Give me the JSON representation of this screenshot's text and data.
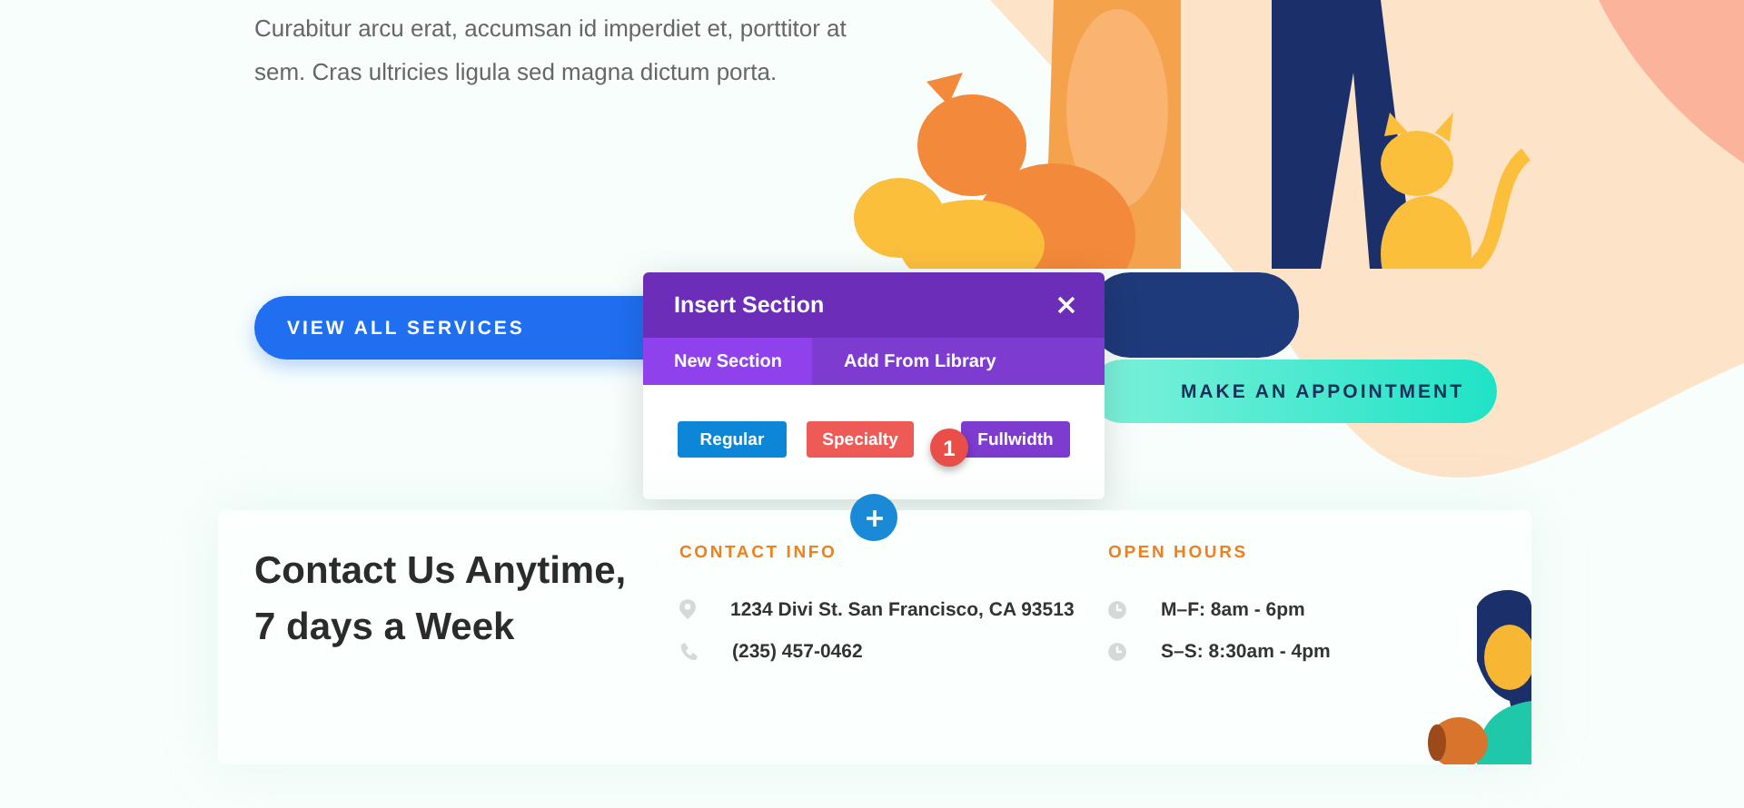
{
  "hero": {
    "text": "Curabitur arcu erat, accumsan id imperdiet et, porttitor at sem. Cras ultricies ligula sed magna dictum porta."
  },
  "buttons": [
    {
      "label": "VIEW ALL SERVICES",
      "kind": "primary"
    },
    {
      "label": "MAKE AN APPOINTMENT",
      "kind": "secondary"
    }
  ],
  "dialog": {
    "title": "Insert Section",
    "tabs": [
      {
        "label": "New Section",
        "selected": true
      },
      {
        "label": "Add From Library",
        "selected": false
      }
    ],
    "options": [
      {
        "label": "Regular",
        "color": "#0c87d8"
      },
      {
        "label": "Specialty",
        "color": "#ee5a55"
      },
      {
        "label": "Fullwidth",
        "color": "#7d3bcf"
      }
    ],
    "badge": "1"
  },
  "contact": {
    "heading": "Contact Us Anytime, 7 days a Week",
    "columns": [
      {
        "title": "CONTACT INFO",
        "rows": [
          {
            "kind": "location",
            "text": "1234 Divi St. San Francisco, CA 93513"
          },
          {
            "kind": "phone",
            "text": "(235) 457-0462"
          }
        ]
      },
      {
        "title": "OPEN HOURS",
        "rows": [
          {
            "kind": "clock",
            "text": "M–F: 8am - 6pm"
          },
          {
            "kind": "clock",
            "text": "S–S: 8:30am - 4pm"
          }
        ]
      }
    ]
  }
}
